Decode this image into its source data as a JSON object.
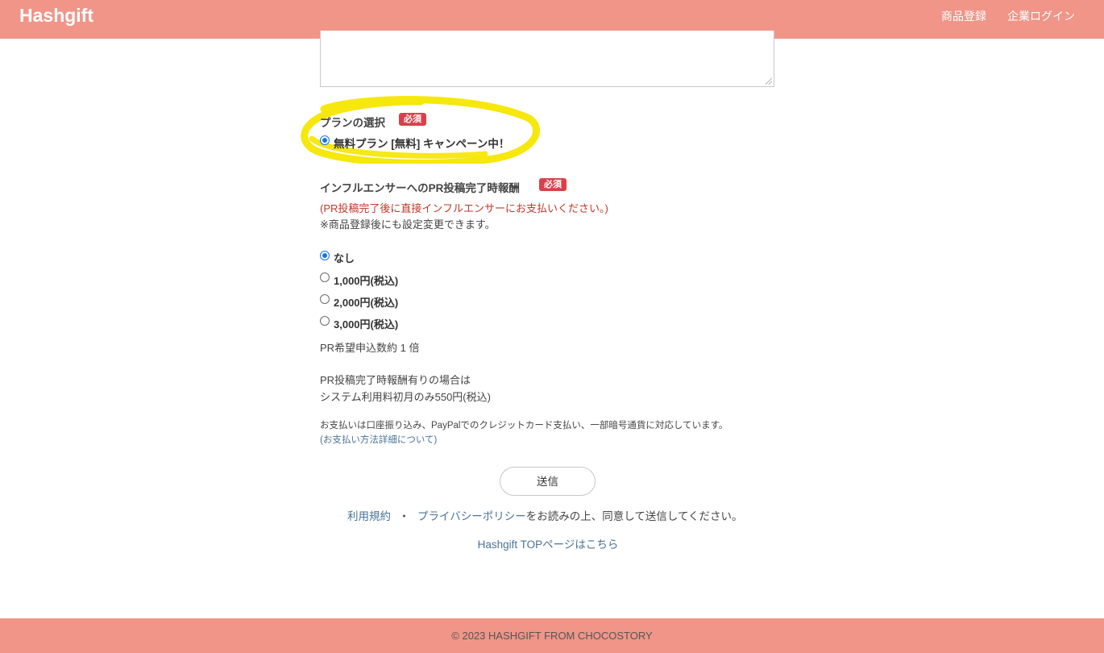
{
  "header": {
    "brand": "Hashgift",
    "nav": {
      "product_register": "商品登録",
      "company_login": "企業ログイン"
    }
  },
  "plan": {
    "label": "プランの選択",
    "required": "必須",
    "options": [
      {
        "label": "無料プラン [無料] キャンペーン中！",
        "checked": true
      }
    ]
  },
  "reward": {
    "label": "インフルエンサーへのPR投稿完了時報酬",
    "required": "必須",
    "note_red": "(PR投稿完了後に直接インフルエンサーにお支払いください。)",
    "note": "※商品登録後にも設定変更できます。",
    "options": [
      {
        "label": "なし",
        "checked": true
      },
      {
        "label": "1,000円(税込)",
        "checked": false
      },
      {
        "label": "2,000円(税込)",
        "checked": false
      },
      {
        "label": "3,000円(税込)",
        "checked": false
      }
    ],
    "multiplier_text": "PR希望申込数約 1 倍",
    "fee_line1": "PR投稿完了時報酬有りの場合は",
    "fee_line2": "システム利用料初月のみ550円(税込)",
    "payment_note": "お支払いは口座振り込み、PayPalでのクレジットカード支払い、一部暗号通貨に対応しています。",
    "payment_link": "(お支払い方法詳細について)"
  },
  "form": {
    "submit": "送信",
    "terms_link": "利用規約",
    "dot": "・",
    "privacy_link": "プライバシーポリシー",
    "agree_text": "をお読みの上、同意して送信してください。",
    "top_link": "Hashgift TOPページはこちら"
  },
  "footer": {
    "copyright": "© 2023 HASHGIFT FROM CHOCOSTORY"
  },
  "colors": {
    "header_bg": "#f09588",
    "highlight": "#f5e600",
    "badge": "#d9414a",
    "link": "#4a7396"
  }
}
